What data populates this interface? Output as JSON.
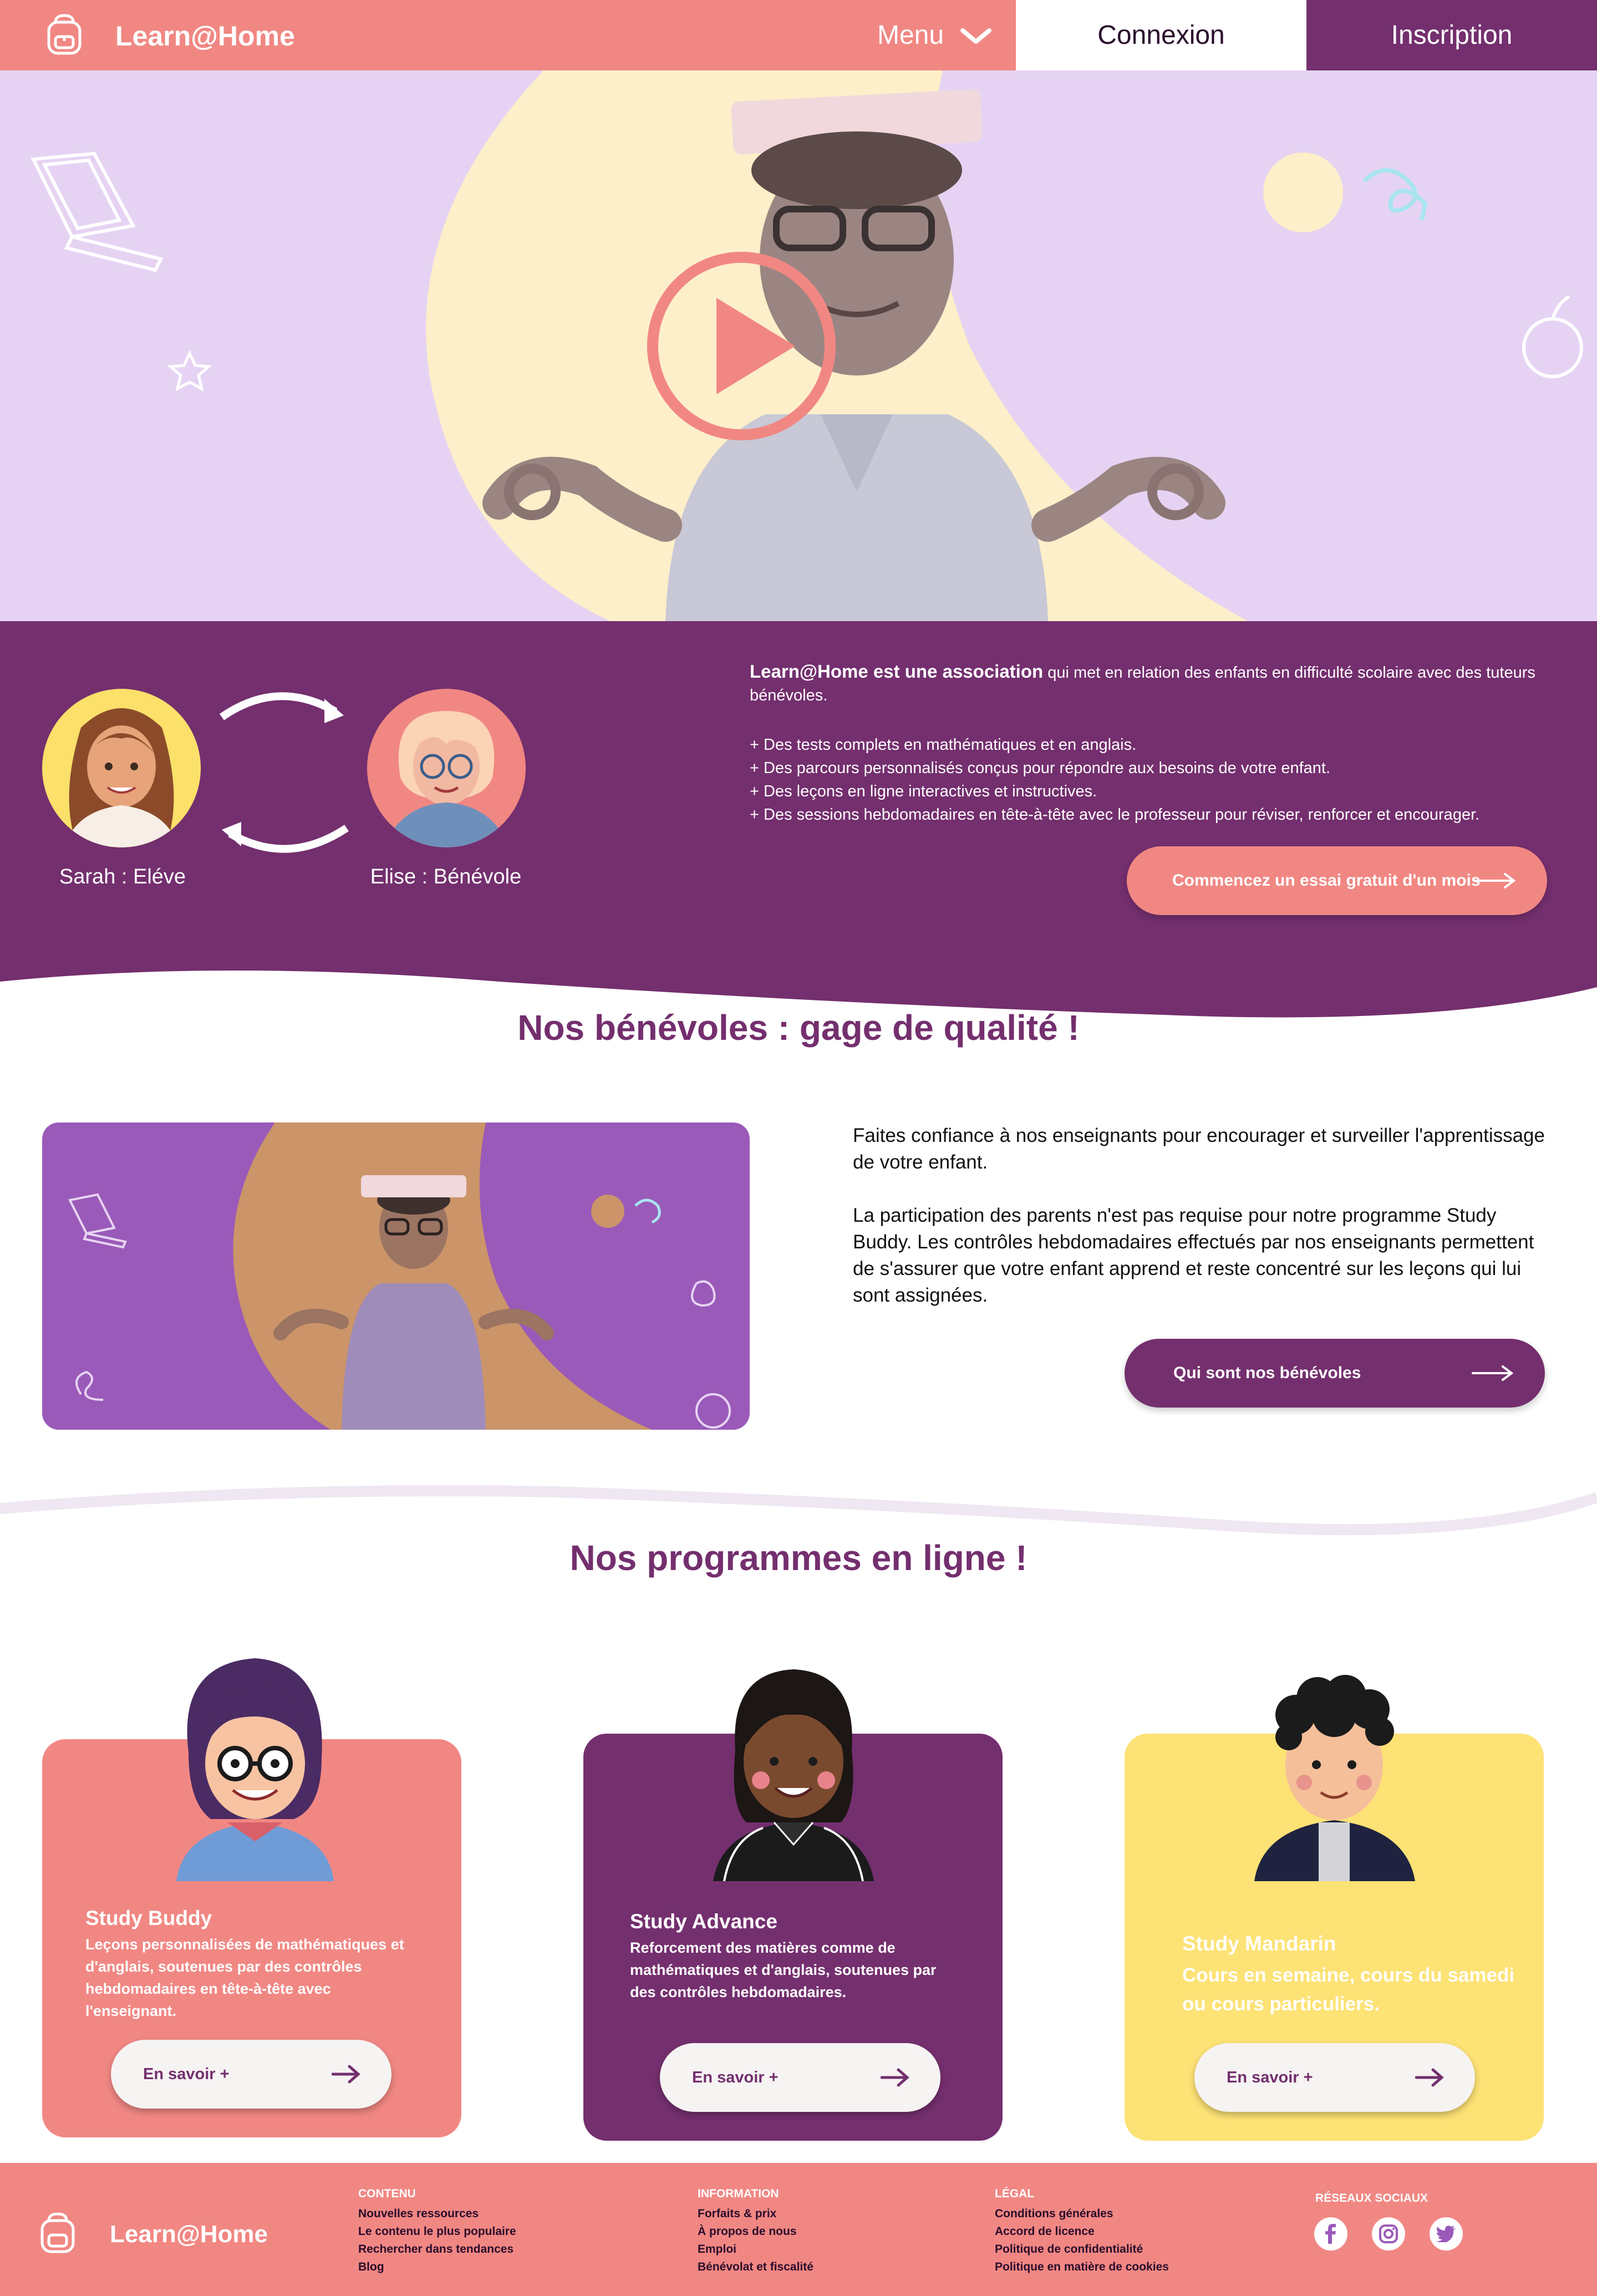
{
  "header": {
    "brand": "Learn@Home",
    "menu_label": "Menu",
    "login_label": "Connexion",
    "signup_label": "Inscription"
  },
  "hero": {
    "play_icon": "play-icon"
  },
  "intro": {
    "student_caption": "Sarah : Eléve",
    "volunteer_caption": "Elise : Bénévole",
    "lead_bold": "Learn@Home est une association",
    "lead_rest": " qui met en relation des enfants en difficulté scolaire avec des tuteurs bénévoles.",
    "bullets": [
      "+ Des tests complets en mathématiques et en anglais.",
      "+ Des parcours personnalisés conçus pour répondre aux besoins de votre enfant.",
      "+ Des leçons en ligne interactives et instructives.",
      "+ Des sessions hebdomadaires en tête-à-tête avec le professeur pour réviser, renforcer et encourager."
    ],
    "trial_button": "Commencez un essai gratuit d'un mois"
  },
  "volunteers": {
    "title": "Nos bénévoles : gage de qualité !",
    "paragraph1": "Faites confiance à nos enseignants pour encourager et surveiller l'apprentissage de votre enfant.",
    "paragraph2": "La participation des parents n'est pas requise pour notre programme Study Buddy. Les contrôles hebdomadaires effectués par nos enseignants permettent de s'assurer que votre enfant apprend et reste concentré sur les leçons qui lui sont assignées.",
    "button": "Qui sont nos bénévoles"
  },
  "programs": {
    "title": "Nos programmes en ligne !",
    "cards": [
      {
        "name": "Study Buddy",
        "desc": "Leçons personnalisées de mathématiques et d'anglais, soutenues par des contrôles hebdomadaires en tête-à-tête avec l'enseignant.",
        "button": "En savoir +"
      },
      {
        "name": "Study Advance",
        "desc": "Reforcement des matières comme de mathématiques et d'anglais, soutenues par des contrôles hebdomadaires.",
        "button": "En savoir +"
      },
      {
        "name": "Study  Mandarin",
        "desc": "Cours en semaine, cours du samedi ou cours particuliers.",
        "button": "En savoir +"
      }
    ]
  },
  "footer": {
    "brand": "Learn@Home",
    "columns": [
      {
        "heading": "CONTENU",
        "items": [
          "Nouvelles ressources",
          "Le contenu le plus populaire",
          "Rechercher dans tendances",
          "Blog"
        ]
      },
      {
        "heading": "INFORMATION",
        "items": [
          "Forfaits & prix",
          "À propos de nous",
          "Emploi",
          "Bénévolat et fiscalité"
        ]
      },
      {
        "heading": "LÉGAL",
        "items": [
          "Conditions générales",
          "Accord de licence",
          "Politique de confidentialité",
          "Politique en matière de cookies"
        ]
      }
    ],
    "social_heading": "RÉSEAUX SOCIAUX",
    "social_icons": [
      "facebook-icon",
      "instagram-icon",
      "twitter-icon"
    ]
  },
  "colors": {
    "coral": "#f18783",
    "plum": "#742f6e",
    "lavender": "#e6d3f3",
    "yellow": "#fde275",
    "violet": "#9a5ab9"
  }
}
